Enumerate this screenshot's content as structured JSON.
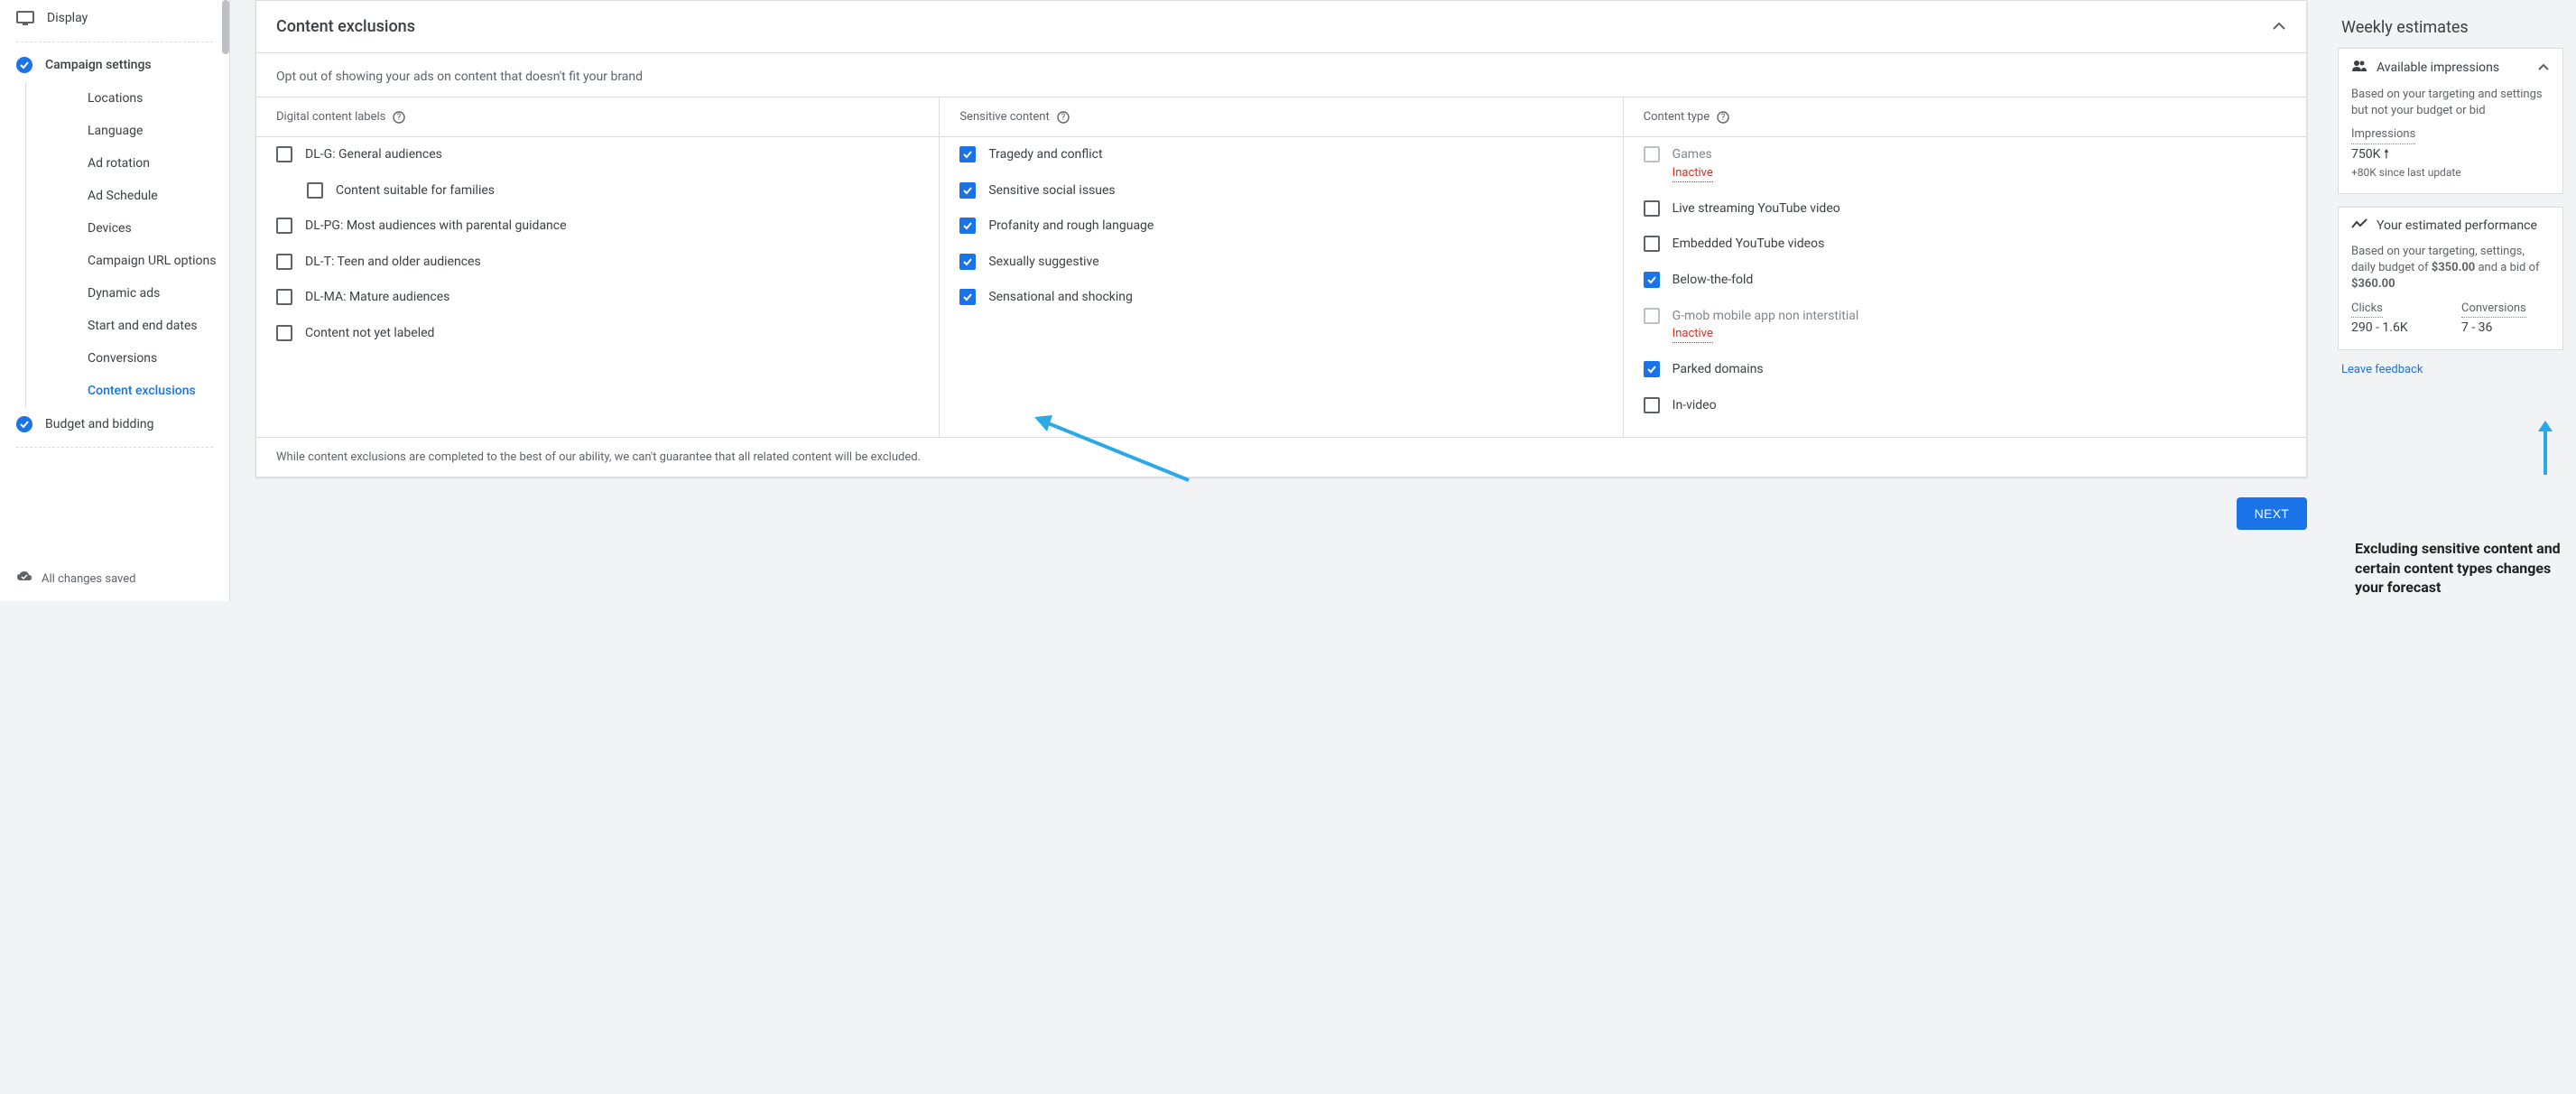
{
  "sidebar": {
    "display": "Display",
    "campaign_settings": "Campaign settings",
    "items": [
      "Locations",
      "Language",
      "Ad rotation",
      "Ad Schedule",
      "Devices",
      "Campaign URL options",
      "Dynamic ads",
      "Start and end dates",
      "Conversions",
      "Content exclusions"
    ],
    "budget": "Budget and bidding",
    "saved": "All changes saved"
  },
  "card": {
    "title": "Content exclusions",
    "subhead": "Opt out of showing your ads on content that doesn't fit your brand",
    "col_digital": "Digital content labels",
    "col_sensitive": "Sensitive content",
    "col_type": "Content type",
    "digital": [
      {
        "label": "DL-G: General audiences"
      },
      {
        "label": "Content suitable for families",
        "sub": true
      },
      {
        "label": "DL-PG: Most audiences with parental guidance"
      },
      {
        "label": "DL-T: Teen and older audiences"
      },
      {
        "label": "DL-MA: Mature audiences"
      },
      {
        "label": "Content not yet labeled"
      }
    ],
    "sensitive": [
      {
        "label": "Tragedy and conflict",
        "checked": true
      },
      {
        "label": "Sensitive social issues",
        "checked": true
      },
      {
        "label": "Profanity and rough language",
        "checked": true
      },
      {
        "label": "Sexually suggestive",
        "checked": true
      },
      {
        "label": "Sensational and shocking",
        "checked": true
      }
    ],
    "types": [
      {
        "label": "Games",
        "disabled": true,
        "inactive": "Inactive"
      },
      {
        "label": "Live streaming YouTube video"
      },
      {
        "label": "Embedded YouTube videos"
      },
      {
        "label": "Below-the-fold",
        "checked": true
      },
      {
        "label": "G-mob mobile app non interstitial",
        "disabled": true,
        "inactive": "Inactive"
      },
      {
        "label": "Parked domains",
        "checked": true
      },
      {
        "label": "In-video"
      }
    ],
    "footnote": "While content exclusions are completed to the best of our ability, we can't guarantee that all related content will be excluded.",
    "next": "NEXT"
  },
  "estimates": {
    "title": "Weekly estimates",
    "impressions_title": "Available impressions",
    "impressions_desc": "Based on your targeting and settings but not your budget or bid",
    "impressions_label": "Impressions",
    "impressions_value": "750K",
    "impressions_delta": "+80K since last update",
    "performance_title": "Your estimated performance",
    "performance_desc_prefix": "Based on your targeting, settings, daily budget of ",
    "budget": "$350.00",
    "middle": " and a bid of ",
    "bid": "$360.00",
    "clicks_label": "Clicks",
    "clicks_value": "290 - 1.6K",
    "conv_label": "Conversions",
    "conv_value": "7 - 36",
    "feedback": "Leave feedback",
    "annotation": "Excluding sensitive content and certain content types changes your forecast"
  }
}
